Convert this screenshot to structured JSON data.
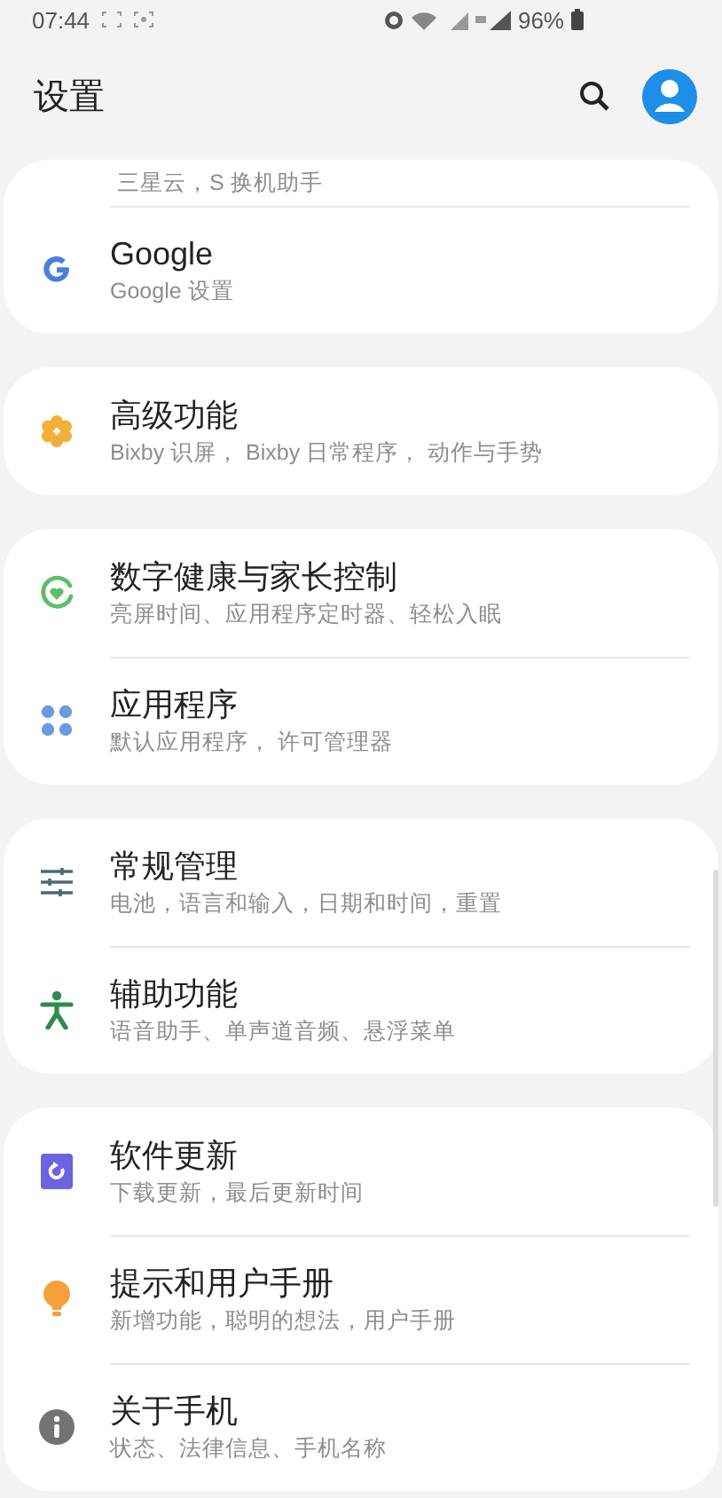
{
  "status_bar": {
    "time": "07:44",
    "battery": "96%"
  },
  "header": {
    "title": "设置"
  },
  "groups": [
    {
      "items": [
        {
          "subtitle": "三星云，S 换机助手"
        },
        {
          "title": "Google",
          "subtitle": "Google 设置"
        }
      ]
    },
    {
      "items": [
        {
          "title": "高级功能",
          "subtitle": "Bixby 识屏， Bixby 日常程序， 动作与手势"
        }
      ]
    },
    {
      "items": [
        {
          "title": "数字健康与家长控制",
          "subtitle": "亮屏时间、应用程序定时器、轻松入眠"
        },
        {
          "title": "应用程序",
          "subtitle": "默认应用程序， 许可管理器"
        }
      ]
    },
    {
      "items": [
        {
          "title": "常规管理",
          "subtitle": "电池，语言和输入，日期和时间，重置"
        },
        {
          "title": "辅助功能",
          "subtitle": "语音助手、单声道音频、悬浮菜单"
        }
      ]
    },
    {
      "items": [
        {
          "title": "软件更新",
          "subtitle": "下载更新，最后更新时间"
        },
        {
          "title": "提示和用户手册",
          "subtitle": "新增功能，聪明的想法，用户手册"
        },
        {
          "title": "关于手机",
          "subtitle": "状态、法律信息、手机名称"
        }
      ]
    }
  ]
}
